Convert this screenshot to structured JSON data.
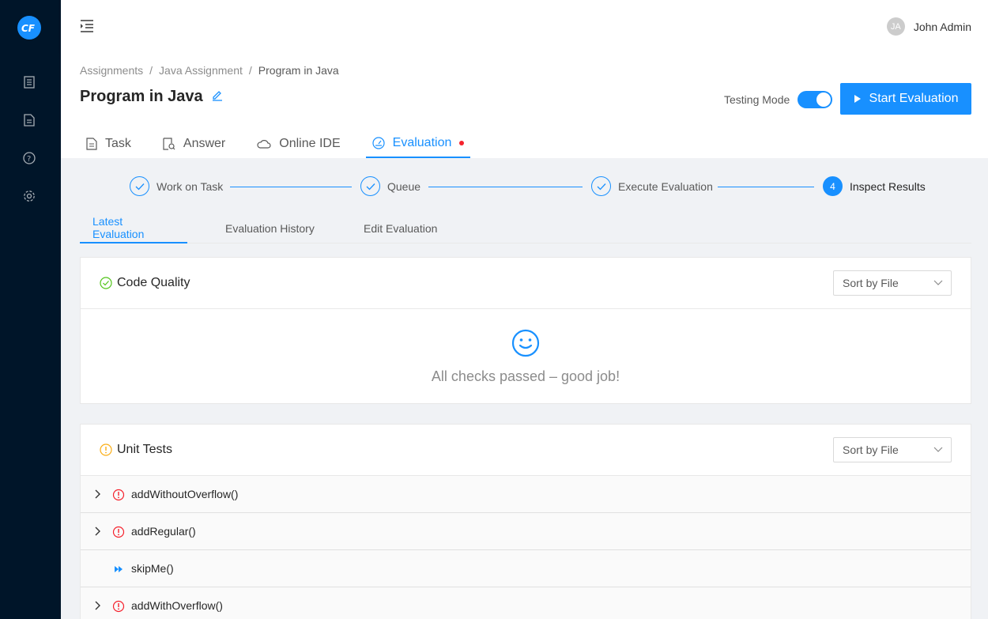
{
  "header": {
    "user_initials": "JA",
    "user_name": "John Admin"
  },
  "logo": {
    "text": "CF"
  },
  "breadcrumb": {
    "items": [
      "Assignments",
      "Java Assignment",
      "Program in Java"
    ],
    "separator": "/"
  },
  "page": {
    "title": "Program in Java",
    "testing_mode_label": "Testing Mode",
    "testing_mode_on": true,
    "start_button": "Start Evaluation"
  },
  "tabs": [
    {
      "label": "Task",
      "icon": "file-icon"
    },
    {
      "label": "Answer",
      "icon": "file-search-icon"
    },
    {
      "label": "Online IDE",
      "icon": "cloud-icon"
    },
    {
      "label": "Evaluation",
      "icon": "dashboard-icon",
      "active": true
    }
  ],
  "steps": [
    {
      "label": "Work on Task"
    },
    {
      "label": "Queue"
    },
    {
      "label": "Execute Evaluation"
    },
    {
      "label": "Inspect Results",
      "number": "4"
    }
  ],
  "subtabs": [
    "Latest Evaluation",
    "Evaluation History",
    "Edit Evaluation"
  ],
  "code_quality": {
    "title": "Code Quality",
    "sort": "Sort by File",
    "message": "All checks passed – good job!"
  },
  "unit_tests": {
    "title": "Unit Tests",
    "sort": "Sort by File",
    "rows": [
      "addWithoutOverflow()",
      "addRegular()",
      "skipMe()",
      "addWithOverflow()"
    ]
  },
  "colors": {
    "primary": "#1890ff",
    "sidebar": "#001529",
    "error": "#f5222d",
    "success": "#52c41a",
    "warning": "#faad14"
  }
}
